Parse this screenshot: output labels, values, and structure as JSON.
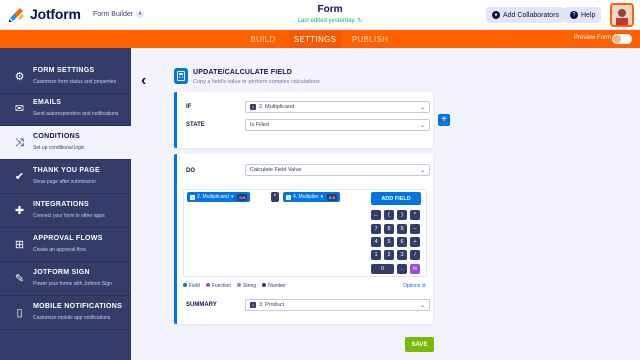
{
  "header": {
    "logo_text": "Jotform",
    "builder_label": "Form Builder",
    "form_title": "Form",
    "last_edited": "Last edited yesterday.",
    "collab_label": "Add Collaborators",
    "help_label": "Help"
  },
  "nav": {
    "tabs": [
      {
        "label": "BUILD",
        "active": false
      },
      {
        "label": "SETTINGS",
        "active": true
      },
      {
        "label": "PUBLISH",
        "active": false
      }
    ],
    "preview_label": "Preview Form",
    "preview_enabled": false
  },
  "sidebar": {
    "items": [
      {
        "title": "FORM SETTINGS",
        "subtitle": "Customize form status and properties",
        "icon": "gear-icon",
        "active": false
      },
      {
        "title": "EMAILS",
        "subtitle": "Send autoresponders and notifications",
        "icon": "envelope-icon",
        "active": false
      },
      {
        "title": "CONDITIONS",
        "subtitle": "Set up conditional logic",
        "icon": "shuffle-icon",
        "active": true
      },
      {
        "title": "THANK YOU PAGE",
        "subtitle": "Show page after submission",
        "icon": "check-circle-icon",
        "active": false
      },
      {
        "title": "INTEGRATIONS",
        "subtitle": "Connect your form to other apps",
        "icon": "puzzle-icon",
        "active": false
      },
      {
        "title": "APPROVAL FLOWS",
        "subtitle": "Create an approval flow",
        "icon": "flow-icon",
        "active": false
      },
      {
        "title": "JOTFORM SIGN",
        "subtitle": "Power your forms with Jotform Sign",
        "icon": "pen-icon",
        "active": false
      },
      {
        "title": "MOBILE NOTIFICATIONS",
        "subtitle": "Customize mobile app notifications",
        "icon": "mobile-icon",
        "active": false
      }
    ]
  },
  "panel": {
    "title": "UPDATE/CALCULATE FIELD",
    "subtitle": "Copy a field's value or perform complex calculations",
    "if_label": "IF",
    "if_value": "2. Multiplicand",
    "state_label": "STATE",
    "state_value": "Is Filled",
    "do_label": "DO",
    "do_value": "Calculate Field Value",
    "formula": {
      "field1": "2. Multiplicand",
      "field1_tag": "0-9",
      "operator": "*",
      "field2": "4. Multiplier",
      "field2_tag": "0-9"
    },
    "add_field_label": "ADD FIELD",
    "keypad": [
      [
        "←",
        "(",
        ")",
        "*"
      ],
      [
        "7",
        "8",
        "9",
        "−"
      ],
      [
        "4",
        "5",
        "6",
        "+"
      ],
      [
        "1",
        "2",
        "3",
        "/"
      ],
      [
        "0",
        ".",
        "fx"
      ]
    ],
    "legend": [
      {
        "label": "Field",
        "color": "#0075e3"
      },
      {
        "label": "Function",
        "color": "#9c4dd3"
      },
      {
        "label": "String",
        "color": "#8d8fa8"
      },
      {
        "label": "Number",
        "color": "#343c6a"
      }
    ],
    "options_label": "Options",
    "summary_label": "SUMMARY",
    "summary_value": "3. Product",
    "save_label": "SAVE"
  }
}
